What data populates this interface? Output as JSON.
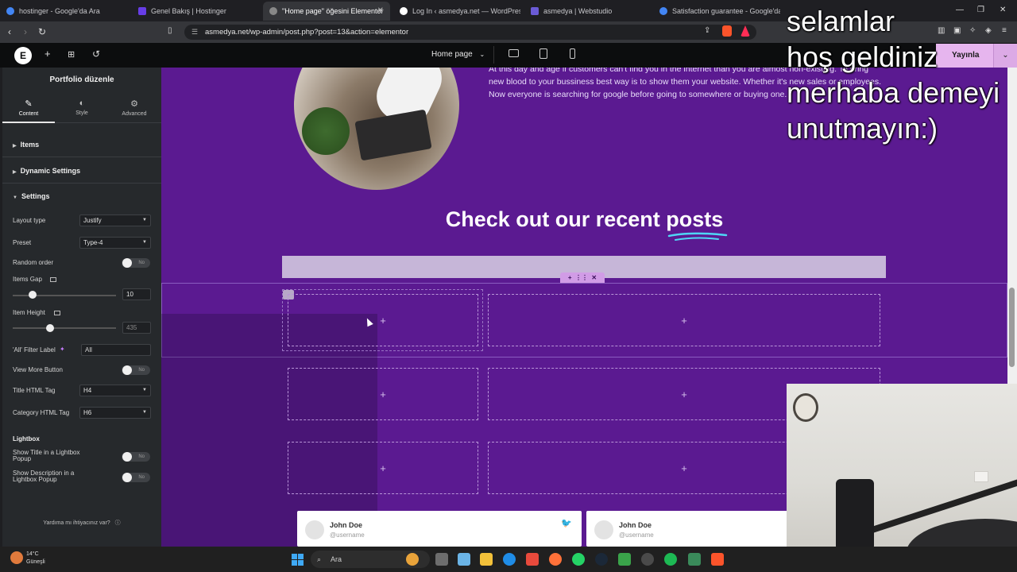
{
  "browser": {
    "tabs": [
      {
        "title": "hostinger - Google'da Ara",
        "color": "#4285f4"
      },
      {
        "title": "Genel Bakış | Hostinger",
        "color": "#673de6"
      },
      {
        "title": "\"Home page\" öğesini Elementor",
        "color": "#888888"
      },
      {
        "title": "Log In ‹ asmedya.net — WordPress",
        "color": "#ffffff"
      },
      {
        "title": "asmedya | Webstudio",
        "color": "#6b5bd6"
      },
      {
        "title": "Satisfaction guarantee - Google'da A",
        "color": "#4285f4"
      }
    ],
    "url": "asmedya.net/wp-admin/post.php?post=13&action=elementor"
  },
  "editor": {
    "logo": "E",
    "page_selector": "Home page",
    "publish_label": "Yayınla"
  },
  "panel": {
    "title": "Portfolio düzenle",
    "tabs": [
      {
        "label": "Content",
        "icon": "pencil-icon"
      },
      {
        "label": "Style",
        "icon": "half-circle-icon"
      },
      {
        "label": "Advanced",
        "icon": "gear-icon"
      }
    ],
    "sections": {
      "items": "Items",
      "dynamic": "Dynamic Settings",
      "settings": "Settings"
    },
    "fields": {
      "layout_type_label": "Layout type",
      "layout_type_value": "Justify",
      "preset_label": "Preset",
      "preset_value": "Type-4",
      "random_order_label": "Random order",
      "random_order_state": "No",
      "items_gap_label": "Items Gap",
      "items_gap_value": "10",
      "item_height_label": "Item Height",
      "item_height_value": "435",
      "all_filter_label": "'All' Filter Label",
      "all_filter_value": "All",
      "view_more_label": "View More Button",
      "view_more_state": "No",
      "title_tag_label": "Title HTML Tag",
      "title_tag_value": "H4",
      "category_tag_label": "Category HTML Tag",
      "category_tag_value": "H6",
      "lightbox_heading": "Lightbox",
      "show_title_label": "Show Title in a Lightbox Popup",
      "show_title_state": "No",
      "show_desc_label": "Show Description in a Lightbox Popup",
      "show_desc_state": "No"
    },
    "help_text": "Yardıma mı ihtiyacınız var?"
  },
  "canvas": {
    "intro_text": "At this day and age if customers can't find you in the internet than you are almost non-existing. To bring new blood to your bussiness best way is to show them your website. Whether it's new sales or employees. Now everyone is searching for google before going to somewhere or buying one.",
    "heading": "Check out our recent posts",
    "plus": "+",
    "cards": [
      {
        "name": "John Doe",
        "user": "@username"
      },
      {
        "name": "John Doe",
        "user": "@username"
      }
    ]
  },
  "overlay": {
    "caption_lines": [
      "selamlar",
      "hoş geldiniz",
      "merhaba demeyi",
      "unutmayın:)"
    ]
  },
  "taskbar": {
    "weather_temp": "14°C",
    "weather_desc": "Güneşli",
    "search_placeholder": "Ara"
  }
}
